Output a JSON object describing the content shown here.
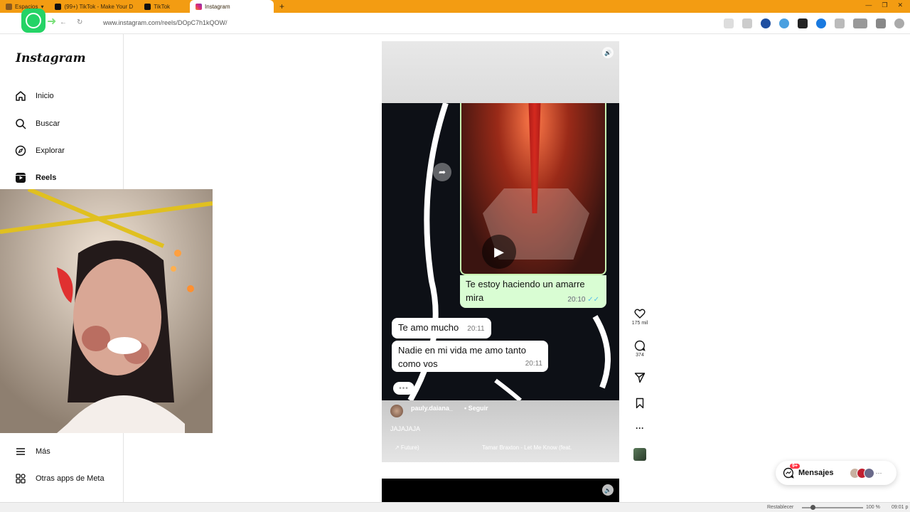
{
  "browser": {
    "tabs": [
      {
        "label": "Espacios"
      },
      {
        "label": "(99+) TikTok - Make Your D"
      },
      {
        "label": "TikTok"
      },
      {
        "label": "Instagram"
      }
    ],
    "new_tab": "+",
    "url": "www.instagram.com/reels/DOpC7h1kQOW/"
  },
  "sidebar": {
    "logo": "Instagram",
    "items": [
      {
        "label": "Inicio",
        "icon": "home-icon"
      },
      {
        "label": "Buscar",
        "icon": "search-icon"
      },
      {
        "label": "Explorar",
        "icon": "compass-icon"
      },
      {
        "label": "Reels",
        "icon": "reels-icon"
      },
      {
        "label": "Más",
        "icon": "menu-icon"
      },
      {
        "label": "Otras apps de Meta",
        "icon": "apps-icon"
      }
    ]
  },
  "reel": {
    "chat": {
      "green_message": "Te estoy haciendo un amarre mira",
      "green_time": "20:10",
      "white_messages": [
        {
          "text": "Te amo mucho",
          "time": "20:11"
        },
        {
          "text": "Nadie en mi vida me amo tanto como vos",
          "time": "20:11"
        }
      ]
    },
    "username": "pauly.daiana_",
    "dot": "•",
    "follow": "Seguir",
    "caption": "JAJAJAJA",
    "music_left": "↗ Future)",
    "music_right": "Tamar Braxton - Let Me Know (feat."
  },
  "actions": {
    "likes": "175 mil",
    "comments": "374"
  },
  "messages": {
    "label": "Mensajes",
    "badge": "9+"
  },
  "statusbar": {
    "restore": "Restablecer",
    "zoom": "100 %",
    "clock": "09:01 p"
  }
}
